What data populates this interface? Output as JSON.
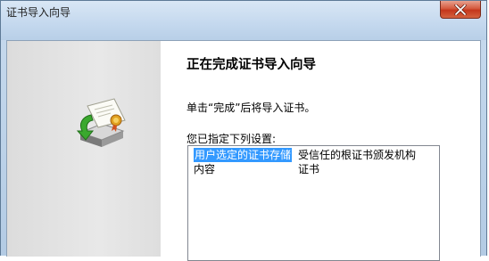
{
  "window": {
    "title": "证书导入向导"
  },
  "wizard": {
    "heading": "正在完成证书导入向导",
    "description": "单击“完成”后将导入证书。",
    "settings_label": "您已指定下列设置:",
    "settings": [
      {
        "key": "用户选定的证书存储",
        "value": "受信任的根证书颁发机构"
      },
      {
        "key": "内容",
        "value": "证书"
      }
    ]
  },
  "icons": {
    "close": "close-icon",
    "certificate": "certificate-import-icon"
  },
  "colors": {
    "selection": "#3399ff",
    "close_button": "#c4361b"
  }
}
